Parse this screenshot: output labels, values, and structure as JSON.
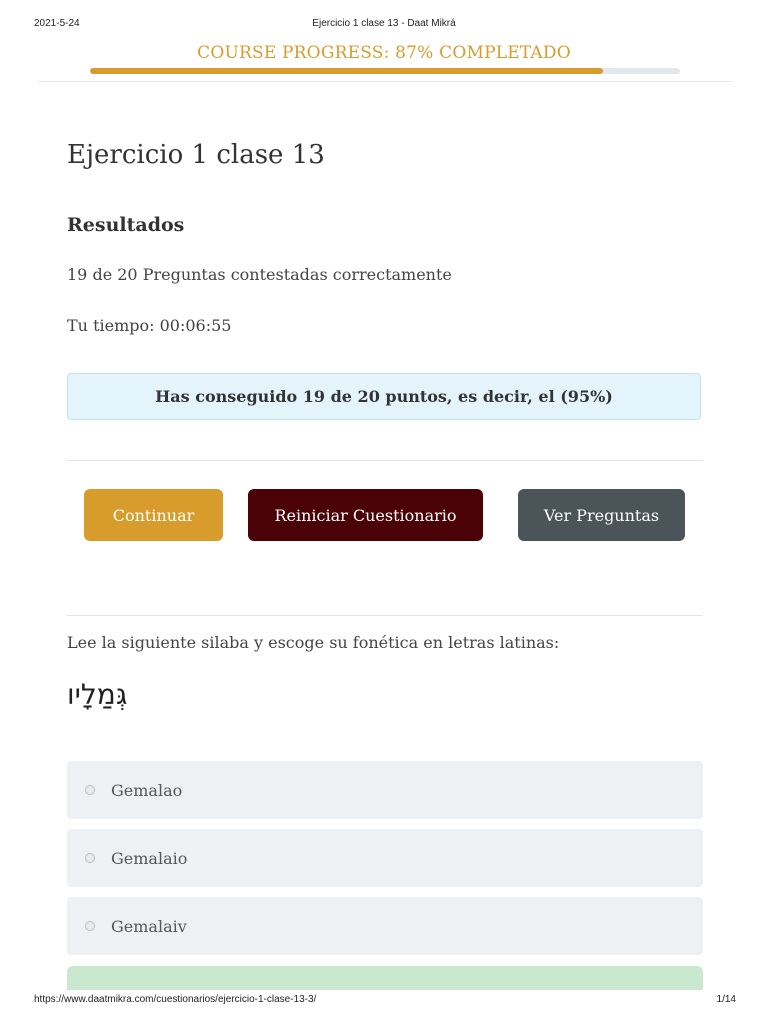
{
  "print_header": {
    "date": "2021-5-24",
    "title": "Ejercicio 1 clase 13 - Daat Mikrá"
  },
  "print_footer": {
    "url": "https://www.daatmikra.com/cuestionarios/ejercicio-1-clase-13-3/",
    "pages": "1/14"
  },
  "course_progress": {
    "label": "COURSE PROGRESS: 87% COMPLETADO",
    "percent": 87,
    "color": "#d89c2c"
  },
  "page_title": "Ejercicio 1 clase 13",
  "results": {
    "heading": "Resultados",
    "correct_count": "19 de 20 Preguntas contestadas correctamente",
    "time": "Tu tiempo: 00:06:55",
    "points_message": "Has conseguido 19 de 20 puntos, es decir, el (95%)"
  },
  "buttons": {
    "continue": "Continuar",
    "restart": "Reiniciar Cuestionario",
    "view_questions": "Ver Preguntas"
  },
  "question": {
    "prompt": "Lee la siguiente silaba y escoge su fonética en letras latinas:",
    "hebrew": "גְּמַלָיו",
    "options": [
      {
        "label": "Gemalao"
      },
      {
        "label": "Gemalaio"
      },
      {
        "label": "Gemalaiv"
      }
    ]
  },
  "colors": {
    "accent": "#d89c2c",
    "restart_button": "#4a0206",
    "view_button": "#4b5458",
    "info_box": "#e3f4fb",
    "correct_option": "#c9e8cd"
  }
}
